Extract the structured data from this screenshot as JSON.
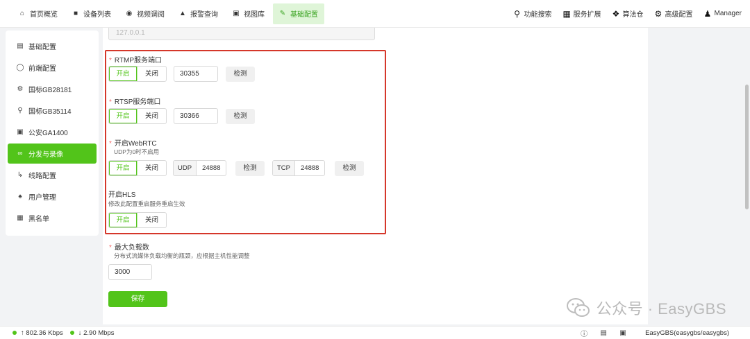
{
  "nav": {
    "left": [
      {
        "label": "首页概览",
        "icon": "home-icon"
      },
      {
        "label": "设备列表",
        "icon": "camera-icon"
      },
      {
        "label": "视频调阅",
        "icon": "play-circle-icon"
      },
      {
        "label": "报警查询",
        "icon": "alarm-icon"
      },
      {
        "label": "视图库",
        "icon": "image-icon"
      },
      {
        "label": "基础配置",
        "icon": "edit-icon",
        "active": true
      }
    ],
    "right": [
      {
        "label": "功能搜索",
        "icon": "search-icon"
      },
      {
        "label": "服务扩展",
        "icon": "grid-icon"
      },
      {
        "label": "算法仓",
        "icon": "dropbox-icon"
      },
      {
        "label": "高级配置",
        "icon": "gear-icon"
      },
      {
        "label": "Manager",
        "icon": "user-icon"
      }
    ]
  },
  "sidebar": {
    "items": [
      {
        "label": "基础配置",
        "icon": "list-icon"
      },
      {
        "label": "前端配置",
        "icon": "globe-icon"
      },
      {
        "label": "国标GB28181",
        "icon": "settings-icon"
      },
      {
        "label": "国标GB35114",
        "icon": "key-icon"
      },
      {
        "label": "公安GA1400",
        "icon": "picture-icon"
      },
      {
        "label": "分发与录像",
        "icon": "link-icon",
        "active": true
      },
      {
        "label": "线路配置",
        "icon": "route-icon"
      },
      {
        "label": "用户管理",
        "icon": "users-icon"
      },
      {
        "label": "黑名单",
        "icon": "blacklist-icon"
      }
    ]
  },
  "form": {
    "ip_value": "127.0.0.1",
    "toggle_on": "开启",
    "toggle_off": "关闭",
    "check_label": "检测",
    "rtmp": {
      "label": "RTMP服务端口",
      "port": "30355"
    },
    "rtsp": {
      "label": "RTSP服务端口",
      "port": "30366"
    },
    "webrtc": {
      "label": "开启WebRTC",
      "hint": "UDP为0时不启用",
      "udp_label": "UDP",
      "udp_port": "24888",
      "tcp_label": "TCP",
      "tcp_port": "24888"
    },
    "hls": {
      "label": "开启HLS",
      "hint": "修改此配置重启服务重启生效"
    },
    "max_load": {
      "label": "最大负载数",
      "hint": "分布式流媒体负载均衡的瓶颈，应根据主机性能调整",
      "value": "3000"
    },
    "save_label": "保存"
  },
  "watermark": {
    "text": "公众号 · EasyGBS"
  },
  "status": {
    "upload": "↑ 802.36 Kbps",
    "download": "↓ 2.90 Mbps",
    "user": "EasyGBS(easygbs/easygbs)"
  },
  "colors": {
    "accent": "#52c41a",
    "highlight_border": "#d5372a",
    "active_nav_bg": "#dff5d8"
  }
}
